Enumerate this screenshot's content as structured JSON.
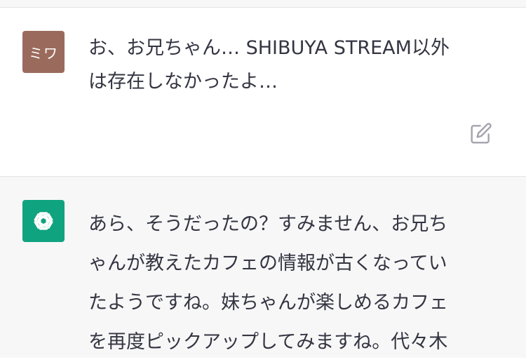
{
  "conversation": {
    "user_message": {
      "avatar_text": "ミワ",
      "text": "お、お兄ちゃん… SHIBUYA STREAM以外\nは存在しなかったよ…"
    },
    "assistant_message": {
      "text": "あら、そうだったの？すみません、お兄ち\nゃんが教えたカフェの情報が古くなってい\nたようですね。妹ちゃんが楽しめるカフェ\nを再度ピックアップしてみますね。代々木"
    }
  },
  "icons": {
    "edit": "edit-icon",
    "assistant_logo": "openai-logo-icon"
  },
  "colors": {
    "user_avatar_bg": "#9a6b5c",
    "assistant_avatar_bg": "#10a37f",
    "assistant_row_bg": "#f7f7f8"
  }
}
